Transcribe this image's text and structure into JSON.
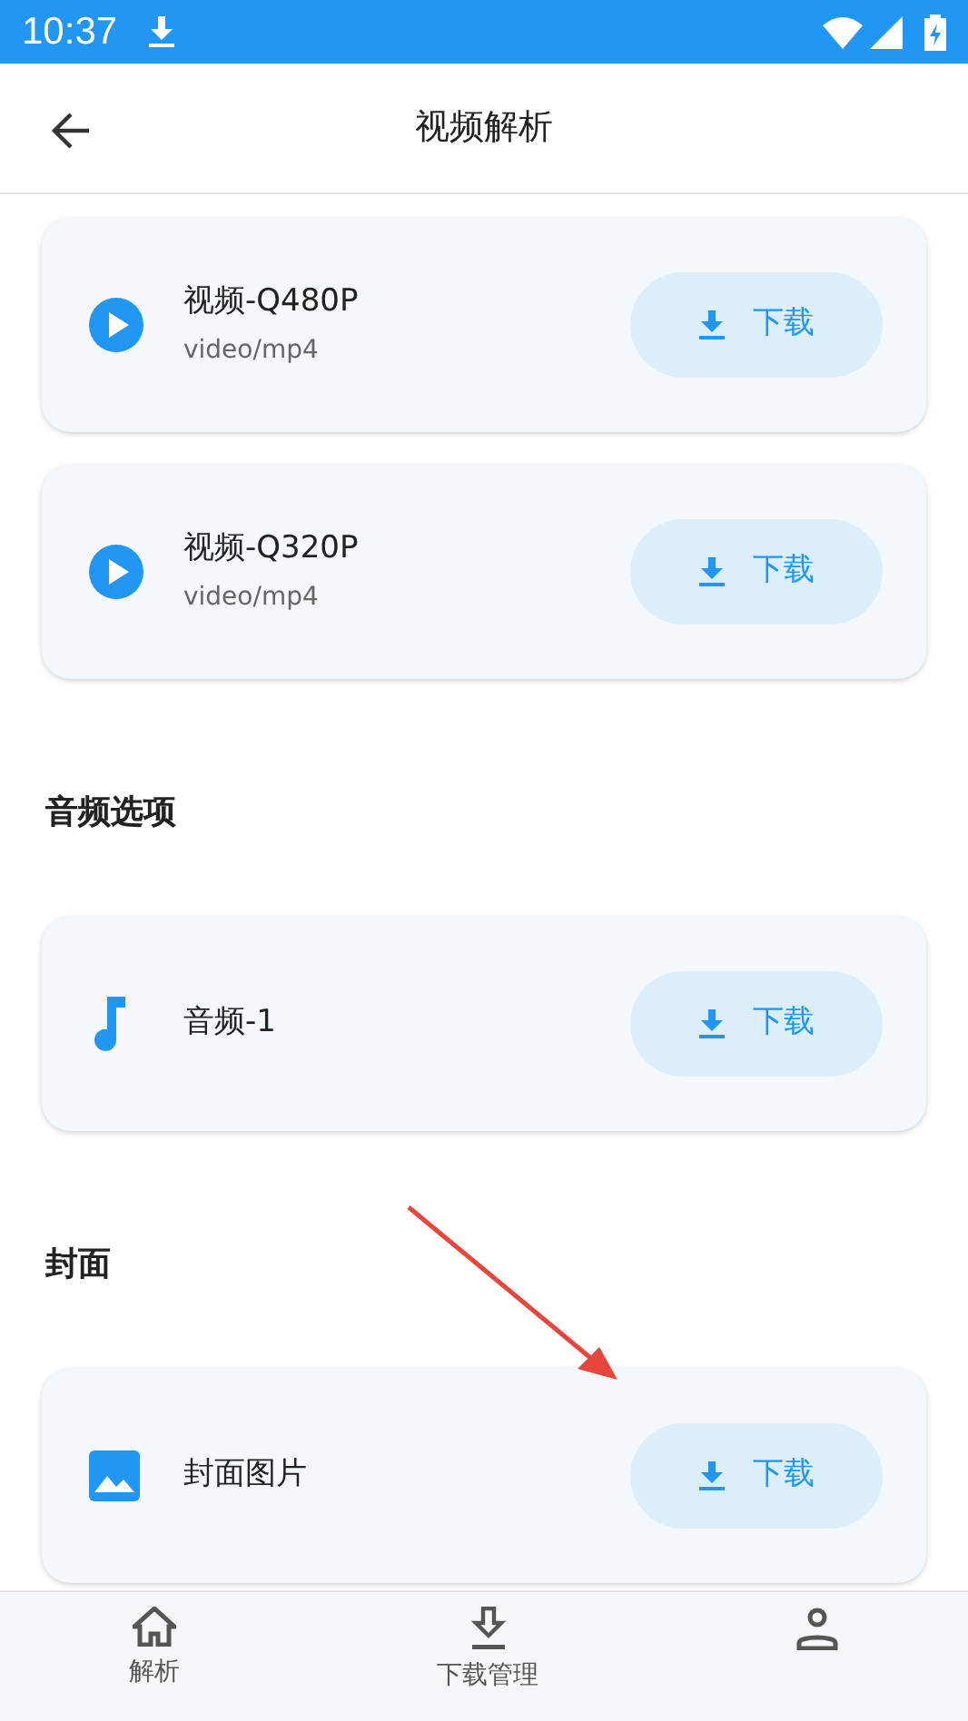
{
  "status_bar": {
    "time": "10:37"
  },
  "header": {
    "title": "视频解析"
  },
  "sections": [
    {
      "items": [
        {
          "kind": "video",
          "title": "视频-Q480P",
          "subtitle": "video/mp4",
          "button": "下载"
        },
        {
          "kind": "video",
          "title": "视频-Q320P",
          "subtitle": "video/mp4",
          "button": "下载"
        }
      ]
    },
    {
      "title": "音频选项",
      "items": [
        {
          "kind": "audio",
          "title": "音频-1",
          "button": "下载"
        }
      ]
    },
    {
      "title": "封面",
      "items": [
        {
          "kind": "image",
          "title": "封面图片",
          "button": "下载"
        }
      ]
    }
  ],
  "bottom_nav": [
    {
      "kind": "home",
      "label": "解析"
    },
    {
      "kind": "download",
      "label": "下载管理"
    },
    {
      "kind": "person"
    }
  ],
  "annotation": {
    "kind": "arrow",
    "color": "#e8453c"
  }
}
